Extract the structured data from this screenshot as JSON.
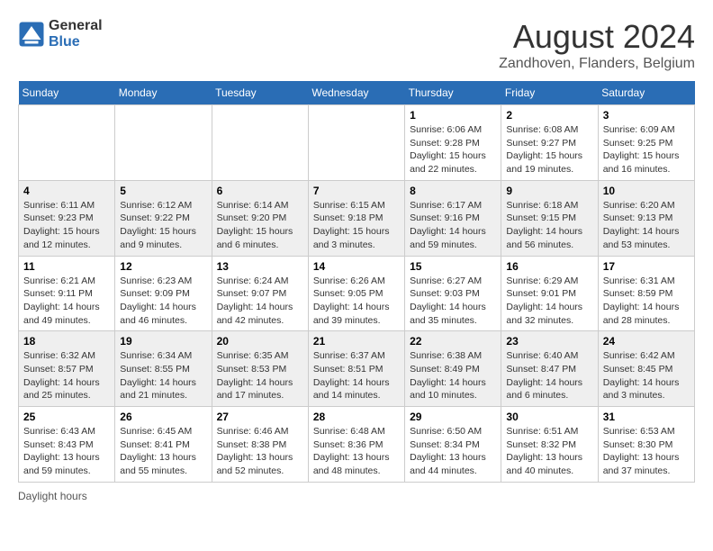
{
  "header": {
    "logo_general": "General",
    "logo_blue": "Blue",
    "month_year": "August 2024",
    "location": "Zandhoven, Flanders, Belgium"
  },
  "weekdays": [
    "Sunday",
    "Monday",
    "Tuesday",
    "Wednesday",
    "Thursday",
    "Friday",
    "Saturday"
  ],
  "footer": {
    "note": "Daylight hours"
  },
  "weeks": [
    [
      {
        "day": "",
        "sunrise": "",
        "sunset": "",
        "daylight": ""
      },
      {
        "day": "",
        "sunrise": "",
        "sunset": "",
        "daylight": ""
      },
      {
        "day": "",
        "sunrise": "",
        "sunset": "",
        "daylight": ""
      },
      {
        "day": "",
        "sunrise": "",
        "sunset": "",
        "daylight": ""
      },
      {
        "day": "1",
        "sunrise": "Sunrise: 6:06 AM",
        "sunset": "Sunset: 9:28 PM",
        "daylight": "Daylight: 15 hours and 22 minutes."
      },
      {
        "day": "2",
        "sunrise": "Sunrise: 6:08 AM",
        "sunset": "Sunset: 9:27 PM",
        "daylight": "Daylight: 15 hours and 19 minutes."
      },
      {
        "day": "3",
        "sunrise": "Sunrise: 6:09 AM",
        "sunset": "Sunset: 9:25 PM",
        "daylight": "Daylight: 15 hours and 16 minutes."
      }
    ],
    [
      {
        "day": "4",
        "sunrise": "Sunrise: 6:11 AM",
        "sunset": "Sunset: 9:23 PM",
        "daylight": "Daylight: 15 hours and 12 minutes."
      },
      {
        "day": "5",
        "sunrise": "Sunrise: 6:12 AM",
        "sunset": "Sunset: 9:22 PM",
        "daylight": "Daylight: 15 hours and 9 minutes."
      },
      {
        "day": "6",
        "sunrise": "Sunrise: 6:14 AM",
        "sunset": "Sunset: 9:20 PM",
        "daylight": "Daylight: 15 hours and 6 minutes."
      },
      {
        "day": "7",
        "sunrise": "Sunrise: 6:15 AM",
        "sunset": "Sunset: 9:18 PM",
        "daylight": "Daylight: 15 hours and 3 minutes."
      },
      {
        "day": "8",
        "sunrise": "Sunrise: 6:17 AM",
        "sunset": "Sunset: 9:16 PM",
        "daylight": "Daylight: 14 hours and 59 minutes."
      },
      {
        "day": "9",
        "sunrise": "Sunrise: 6:18 AM",
        "sunset": "Sunset: 9:15 PM",
        "daylight": "Daylight: 14 hours and 56 minutes."
      },
      {
        "day": "10",
        "sunrise": "Sunrise: 6:20 AM",
        "sunset": "Sunset: 9:13 PM",
        "daylight": "Daylight: 14 hours and 53 minutes."
      }
    ],
    [
      {
        "day": "11",
        "sunrise": "Sunrise: 6:21 AM",
        "sunset": "Sunset: 9:11 PM",
        "daylight": "Daylight: 14 hours and 49 minutes."
      },
      {
        "day": "12",
        "sunrise": "Sunrise: 6:23 AM",
        "sunset": "Sunset: 9:09 PM",
        "daylight": "Daylight: 14 hours and 46 minutes."
      },
      {
        "day": "13",
        "sunrise": "Sunrise: 6:24 AM",
        "sunset": "Sunset: 9:07 PM",
        "daylight": "Daylight: 14 hours and 42 minutes."
      },
      {
        "day": "14",
        "sunrise": "Sunrise: 6:26 AM",
        "sunset": "Sunset: 9:05 PM",
        "daylight": "Daylight: 14 hours and 39 minutes."
      },
      {
        "day": "15",
        "sunrise": "Sunrise: 6:27 AM",
        "sunset": "Sunset: 9:03 PM",
        "daylight": "Daylight: 14 hours and 35 minutes."
      },
      {
        "day": "16",
        "sunrise": "Sunrise: 6:29 AM",
        "sunset": "Sunset: 9:01 PM",
        "daylight": "Daylight: 14 hours and 32 minutes."
      },
      {
        "day": "17",
        "sunrise": "Sunrise: 6:31 AM",
        "sunset": "Sunset: 8:59 PM",
        "daylight": "Daylight: 14 hours and 28 minutes."
      }
    ],
    [
      {
        "day": "18",
        "sunrise": "Sunrise: 6:32 AM",
        "sunset": "Sunset: 8:57 PM",
        "daylight": "Daylight: 14 hours and 25 minutes."
      },
      {
        "day": "19",
        "sunrise": "Sunrise: 6:34 AM",
        "sunset": "Sunset: 8:55 PM",
        "daylight": "Daylight: 14 hours and 21 minutes."
      },
      {
        "day": "20",
        "sunrise": "Sunrise: 6:35 AM",
        "sunset": "Sunset: 8:53 PM",
        "daylight": "Daylight: 14 hours and 17 minutes."
      },
      {
        "day": "21",
        "sunrise": "Sunrise: 6:37 AM",
        "sunset": "Sunset: 8:51 PM",
        "daylight": "Daylight: 14 hours and 14 minutes."
      },
      {
        "day": "22",
        "sunrise": "Sunrise: 6:38 AM",
        "sunset": "Sunset: 8:49 PM",
        "daylight": "Daylight: 14 hours and 10 minutes."
      },
      {
        "day": "23",
        "sunrise": "Sunrise: 6:40 AM",
        "sunset": "Sunset: 8:47 PM",
        "daylight": "Daylight: 14 hours and 6 minutes."
      },
      {
        "day": "24",
        "sunrise": "Sunrise: 6:42 AM",
        "sunset": "Sunset: 8:45 PM",
        "daylight": "Daylight: 14 hours and 3 minutes."
      }
    ],
    [
      {
        "day": "25",
        "sunrise": "Sunrise: 6:43 AM",
        "sunset": "Sunset: 8:43 PM",
        "daylight": "Daylight: 13 hours and 59 minutes."
      },
      {
        "day": "26",
        "sunrise": "Sunrise: 6:45 AM",
        "sunset": "Sunset: 8:41 PM",
        "daylight": "Daylight: 13 hours and 55 minutes."
      },
      {
        "day": "27",
        "sunrise": "Sunrise: 6:46 AM",
        "sunset": "Sunset: 8:38 PM",
        "daylight": "Daylight: 13 hours and 52 minutes."
      },
      {
        "day": "28",
        "sunrise": "Sunrise: 6:48 AM",
        "sunset": "Sunset: 8:36 PM",
        "daylight": "Daylight: 13 hours and 48 minutes."
      },
      {
        "day": "29",
        "sunrise": "Sunrise: 6:50 AM",
        "sunset": "Sunset: 8:34 PM",
        "daylight": "Daylight: 13 hours and 44 minutes."
      },
      {
        "day": "30",
        "sunrise": "Sunrise: 6:51 AM",
        "sunset": "Sunset: 8:32 PM",
        "daylight": "Daylight: 13 hours and 40 minutes."
      },
      {
        "day": "31",
        "sunrise": "Sunrise: 6:53 AM",
        "sunset": "Sunset: 8:30 PM",
        "daylight": "Daylight: 13 hours and 37 minutes."
      }
    ]
  ]
}
